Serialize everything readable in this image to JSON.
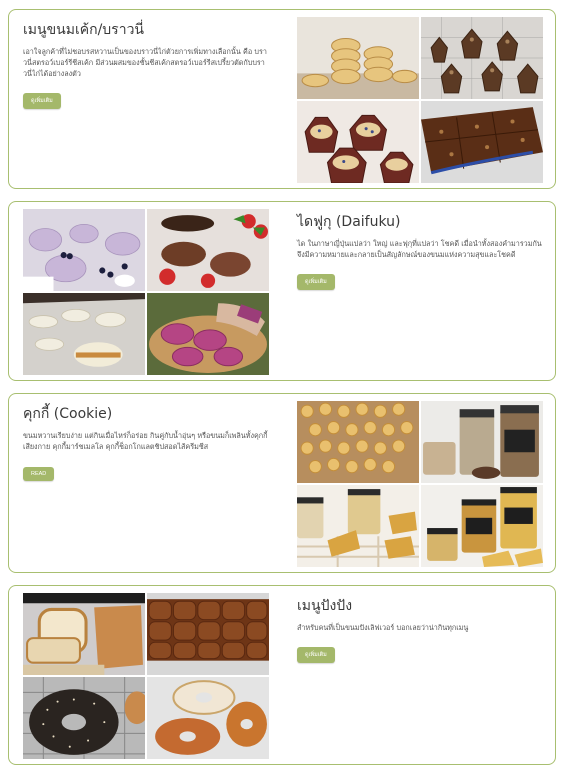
{
  "cards": [
    {
      "title": "เมนูขนมเค้ก/บราวนี่",
      "description": "เอาใจลูกค้าที่ไม่ชอบรสหวานเป็นของบราวนี่ไก่ตัวยการเพิ่มทางเลือกนั้น คือ บราวนี่สตรอว์เบอร์รีชีสเค้ก มีส่วนผสมของชั้นชีสเค้กสตรอว์เบอร์รีสเปรี้ยวตัดกับบราวนี่ไก่ได้อย่างลงตัว",
      "button": "ดูเพิ่มเติม",
      "images": [
        "scones-stack",
        "brownie-cupcakes-nuts",
        "muffins-paper-cups",
        "brownie-tray"
      ]
    },
    {
      "title": "ไดฟูกุ (Daifuku)",
      "description": "ได ในภาษาญี่ปุ่นแปลว่า ใหญ่ และฟุกุที่แปลว่า โชคดี เมื่อนำทั้งสองคำมารวมกันจึงมีความหมายและกลายเป็นสัญลักษณ์ของขนมแห่งความสุขและโชคดี",
      "button": "ดูเพิ่มเติม",
      "images": [
        "daifuku-blueberry",
        "daifuku-chocolate-strawberry",
        "daifuku-white",
        "daifuku-purple-sweet-potato"
      ]
    },
    {
      "title": "คุกกี้ (Cookie)",
      "description": "ขนมหวานเรียบง่าย แต่กินเมื่อไหร่ก็อร่อย กินคู่กับน้ำอุ่นๆ หรือขนมก็เพลินทั้งคุกกี้เสียงกาย คุกกี้มาร์ชเมลโล คุกกี้ช็อกโกแลตชิปสอดไส้ครีมชีส",
      "button": "READ",
      "images": [
        "butter-cookies-tray",
        "cookie-jars",
        "cookie-jar-open",
        "premium-cookie-jars"
      ]
    },
    {
      "title": "เมนูปังปัง",
      "description": "สำหรับคนที่เป็นขนมปังเลิฟเวอร์ บอกเลยว่าน่ากินทุกเมนู",
      "button": "ดูเพิ่มเติม",
      "images": [
        "sliced-bread-loaf",
        "dinner-rolls-tray",
        "sesame-bagel",
        "plain-bagels"
      ]
    }
  ]
}
